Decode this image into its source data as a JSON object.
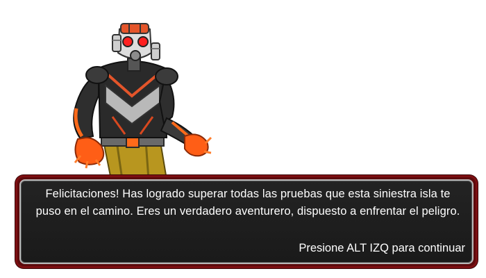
{
  "character": {
    "icon": "gas-mask-robot-character"
  },
  "dialog": {
    "message": "Felicitaciones! Has logrado superar todas las pruebas que esta siniestra isla te puso en el camino. Eres un verdadero aventurero, dispuesto a enfrentar el peligro.",
    "continue_prompt": "Presione ALT IZQ para continuar",
    "colors": {
      "border": "#7d0f12",
      "background": "#1f1f1f",
      "text": "#ffffff"
    }
  }
}
